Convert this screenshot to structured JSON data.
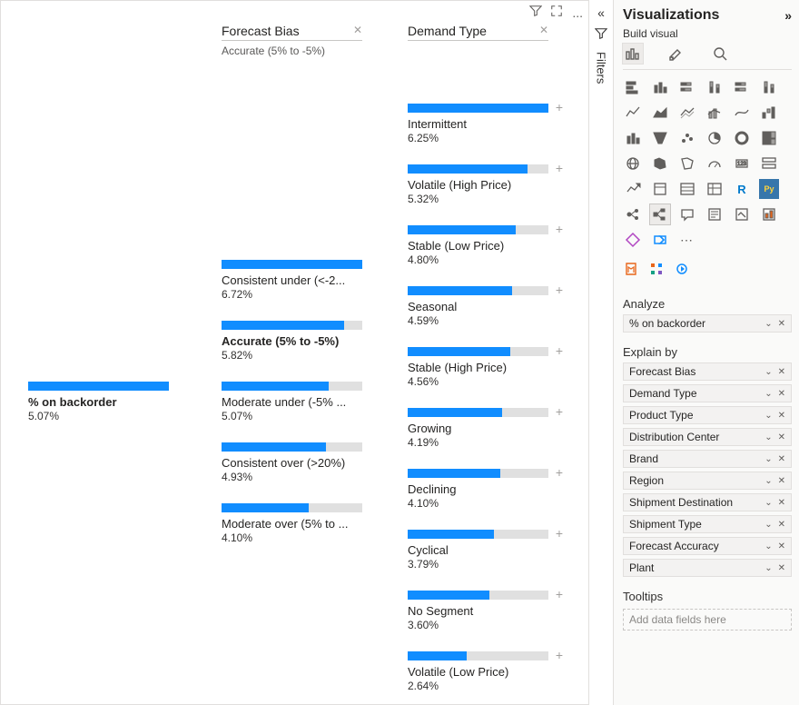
{
  "canvas": {
    "toolbar": {
      "filter": "filter-icon",
      "focus": "focus-icon",
      "more": "..."
    },
    "root": {
      "label": "% on backorder",
      "value": "5.07%",
      "fill": 100
    },
    "col1": {
      "header": "Forecast Bias",
      "sub": "Accurate (5% to -5%)",
      "items": [
        {
          "label": "Consistent under (<-2...",
          "value": "6.72%",
          "fill": 100
        },
        {
          "label": "Accurate (5% to -5%)",
          "value": "5.82%",
          "fill": 87,
          "selected": true
        },
        {
          "label": "Moderate under (-5% ...",
          "value": "5.07%",
          "fill": 76
        },
        {
          "label": "Consistent over (>20%)",
          "value": "4.93%",
          "fill": 74
        },
        {
          "label": "Moderate over (5% to ...",
          "value": "4.10%",
          "fill": 62
        }
      ]
    },
    "col2": {
      "header": "Demand Type",
      "items": [
        {
          "label": "Intermittent",
          "value": "6.25%",
          "fill": 100
        },
        {
          "label": "Volatile (High Price)",
          "value": "5.32%",
          "fill": 85
        },
        {
          "label": "Stable (Low Price)",
          "value": "4.80%",
          "fill": 77
        },
        {
          "label": "Seasonal",
          "value": "4.59%",
          "fill": 74
        },
        {
          "label": "Stable (High Price)",
          "value": "4.56%",
          "fill": 73
        },
        {
          "label": "Growing",
          "value": "4.19%",
          "fill": 67
        },
        {
          "label": "Declining",
          "value": "4.10%",
          "fill": 66
        },
        {
          "label": "Cyclical",
          "value": "3.79%",
          "fill": 61
        },
        {
          "label": "No Segment",
          "value": "3.60%",
          "fill": 58
        },
        {
          "label": "Volatile (Low Price)",
          "value": "2.64%",
          "fill": 42
        }
      ]
    }
  },
  "filtersRail": {
    "label": "Filters"
  },
  "vpane": {
    "title": "Visualizations",
    "sub": "Build visual",
    "analyze": {
      "header": "Analyze",
      "field": "% on backorder"
    },
    "explain": {
      "header": "Explain by",
      "fields": [
        "Forecast Bias",
        "Demand Type",
        "Product Type",
        "Distribution Center",
        "Brand",
        "Region",
        "Shipment Destination",
        "Shipment Type",
        "Forecast Accuracy",
        "Plant"
      ]
    },
    "tooltips": {
      "header": "Tooltips",
      "placeholder": "Add data fields here"
    }
  }
}
